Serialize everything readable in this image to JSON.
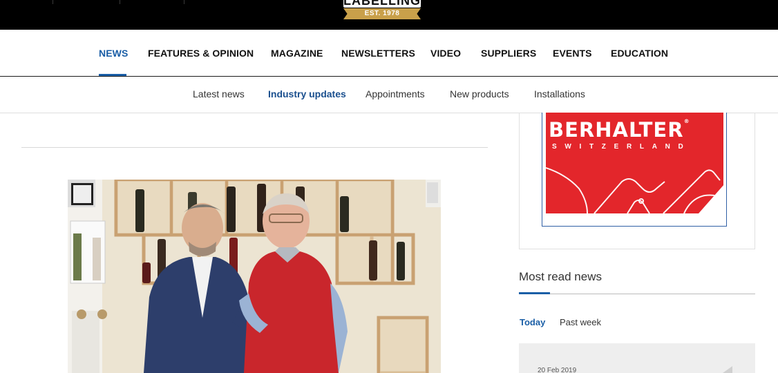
{
  "header": {
    "logo_word": "LABELLING",
    "logo_est": "EST. 1978"
  },
  "main_nav": {
    "items": [
      {
        "label": "NEWS",
        "active": true
      },
      {
        "label": "FEATURES & OPINION",
        "active": false
      },
      {
        "label": "MAGAZINE",
        "active": false
      },
      {
        "label": "NEWSLETTERS",
        "active": false
      },
      {
        "label": "VIDEO",
        "active": false
      },
      {
        "label": "SUPPLIERS",
        "active": false
      },
      {
        "label": "EVENTS",
        "active": false
      },
      {
        "label": "EDUCATION",
        "active": false
      }
    ]
  },
  "sub_nav": {
    "items": [
      {
        "label": "Latest news",
        "active": false
      },
      {
        "label": "Industry updates",
        "active": true
      },
      {
        "label": "Appointments",
        "active": false
      },
      {
        "label": "New products",
        "active": false
      },
      {
        "label": "Installations",
        "active": false
      }
    ]
  },
  "advert": {
    "brand": "BERHALTER",
    "country": "SWITZERLAND",
    "background_color": "#e3262b"
  },
  "most_read": {
    "title": "Most read news",
    "tabs": [
      {
        "label": "Today",
        "active": true
      },
      {
        "label": "Past week",
        "active": false
      }
    ],
    "items": [
      {
        "date": "20 Feb 2019"
      }
    ]
  },
  "colors": {
    "accent": "#1a5ea6",
    "top_bar": "#000000",
    "logo_gold": "#c9a04a"
  }
}
